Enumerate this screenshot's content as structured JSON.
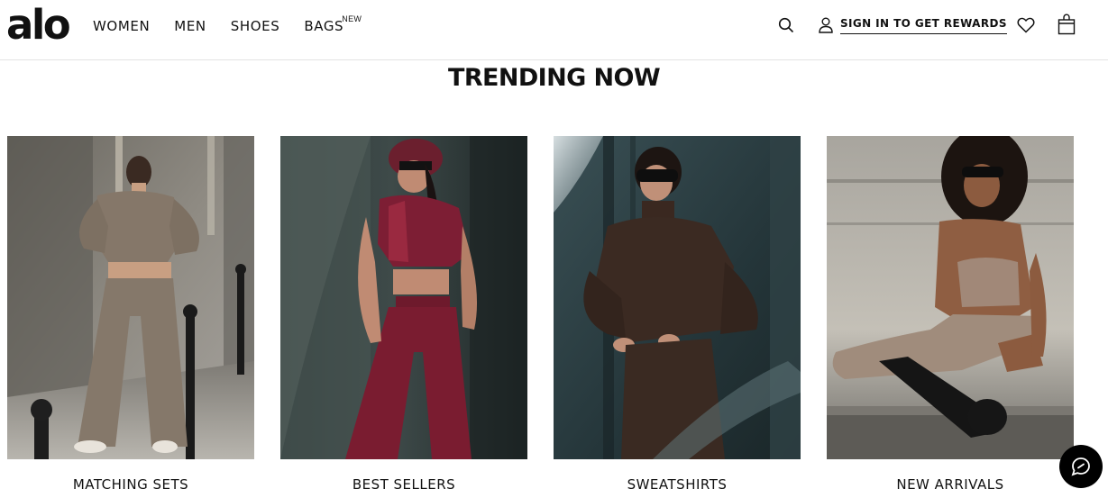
{
  "brand": {
    "logo_text": "alo"
  },
  "nav": {
    "items": [
      {
        "label": "WOMEN"
      },
      {
        "label": "MEN"
      },
      {
        "label": "SHOES"
      },
      {
        "label": "BAGS",
        "badge": "NEW"
      }
    ]
  },
  "header": {
    "search_icon": "search-icon",
    "signin_label": "SIGN IN TO GET REWARDS",
    "user_icon": "user-icon",
    "wishlist_icon": "heart-icon",
    "bag_icon": "shopping-bag-icon"
  },
  "section": {
    "title": "TRENDING NOW"
  },
  "cards": [
    {
      "label": "MATCHING SETS"
    },
    {
      "label": "BEST SELLERS"
    },
    {
      "label": "SWEATSHIRTS"
    },
    {
      "label": "NEW ARRIVALS"
    }
  ],
  "chat": {
    "icon": "chat-icon"
  },
  "colors": {
    "text": "#111111",
    "background": "#ffffff",
    "divider": "#e3e3e3",
    "chat_button": "#000000"
  }
}
